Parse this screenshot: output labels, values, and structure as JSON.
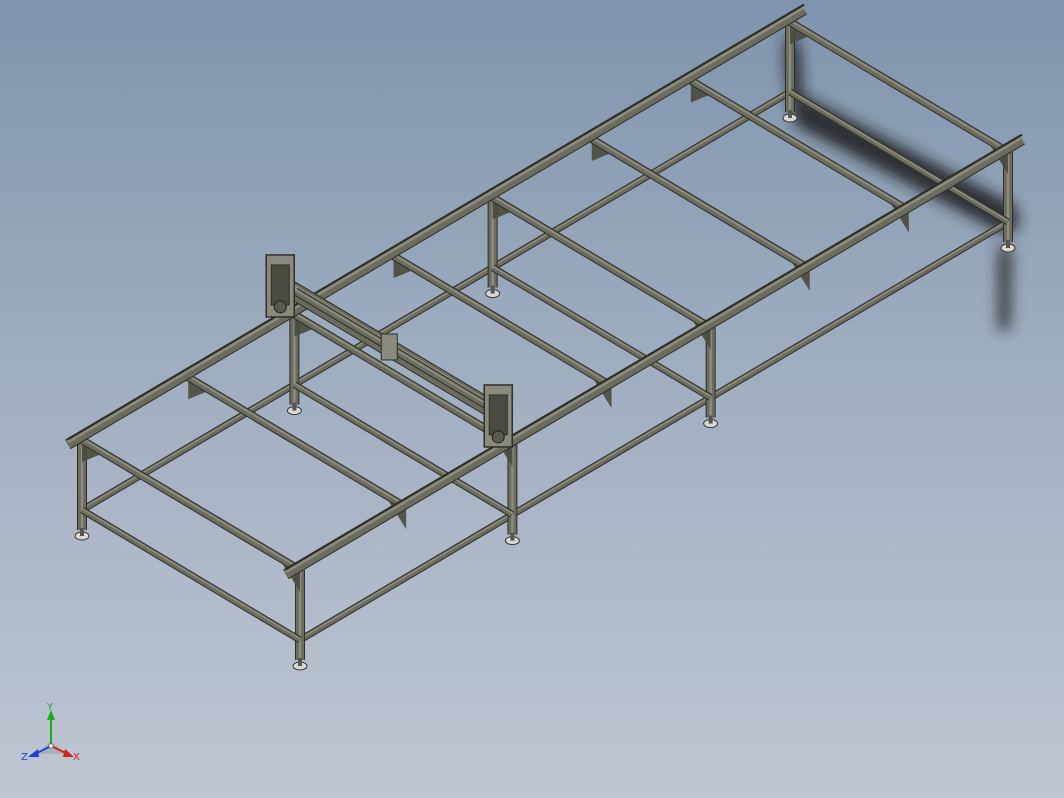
{
  "viewport": {
    "background_top": "#7f94ad",
    "background_bottom": "#bfc6d3"
  },
  "model": {
    "frame_color": "#6c6c5e",
    "frame_shadow": "#4a4a3e",
    "frame_dark": "#2f2f29",
    "foot_color": "#d8d8d0",
    "carriage_color": "#8a8a7c"
  },
  "triad": {
    "x_label": "X",
    "y_label": "Y",
    "z_label": "Z",
    "x_color": "#d62020",
    "y_color": "#18b018",
    "z_color": "#2040d0"
  }
}
